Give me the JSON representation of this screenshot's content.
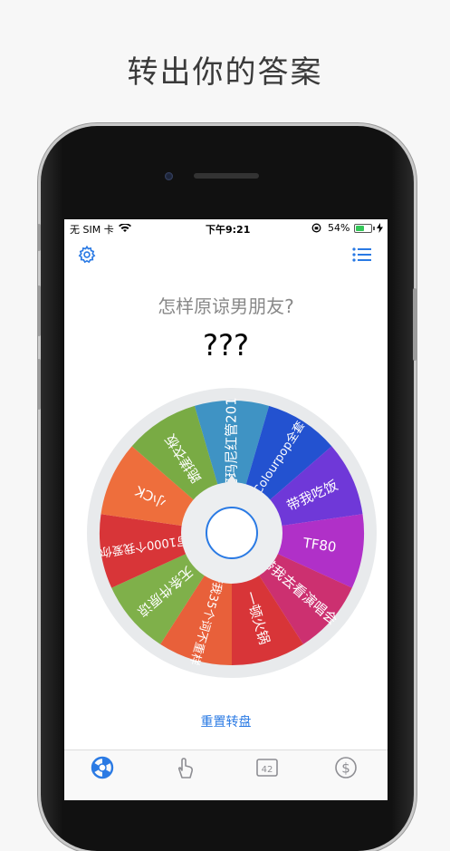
{
  "headline": "转出你的答案",
  "status_bar": {
    "carrier": "无 SIM 卡",
    "time": "下午9:21",
    "battery": "54%",
    "battery_level": 0.54
  },
  "toolbar": {
    "settings_icon": "gear-icon",
    "list_icon": "list-icon"
  },
  "question": "怎样原谅男朋友?",
  "answer": "???",
  "wheel": {
    "segments": [
      {
        "label": "阿玛尼红管201",
        "color": "#3f93c4"
      },
      {
        "label": "Colourpop全套",
        "color": "#2352d0"
      },
      {
        "label": "带我吃饭",
        "color": "#6f38d8"
      },
      {
        "label": "TF80",
        "color": "#b030c8"
      },
      {
        "label": "带我去看演唱会",
        "color": "#cc3070"
      },
      {
        "label": "一顿火锅",
        "color": "#d83538"
      },
      {
        "label": "夸我35个词不重样",
        "color": "#e8603a"
      },
      {
        "label": "无条件原谅",
        "color": "#7fb04a"
      },
      {
        "label": "写1000个我爱你",
        "color": "#d83538"
      },
      {
        "label": "小CK",
        "color": "#ee6e3c"
      },
      {
        "label": "跪搓衣板",
        "color": "#79ab44"
      }
    ],
    "spin_button": "spin-button"
  },
  "reset_button": "重置转盘",
  "tabs": [
    {
      "icon": "wheel-icon",
      "active": true
    },
    {
      "icon": "tap-hand-icon",
      "active": false
    },
    {
      "icon": "number-icon",
      "text": "42",
      "active": false
    },
    {
      "icon": "dollar-icon",
      "active": false
    }
  ],
  "colors": {
    "accent": "#2a7ae4",
    "inactive": "#8e8e93"
  }
}
